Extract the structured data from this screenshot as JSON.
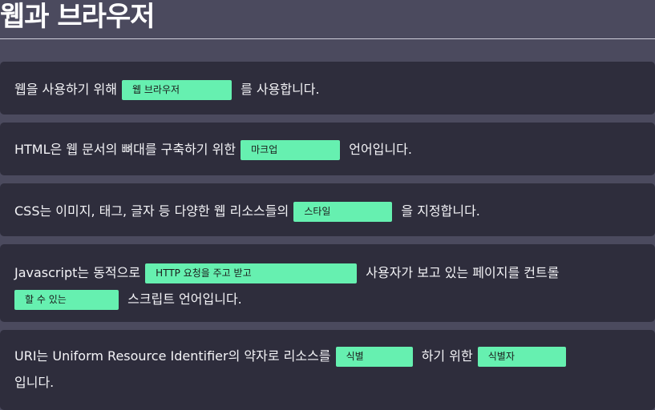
{
  "page": {
    "title": "웹과 브라우저"
  },
  "colors": {
    "page_background": "#4b4a5e",
    "card_background": "#2e2d3c",
    "blank_fill": "#66f0b0",
    "text": "#f4f4f7"
  },
  "cards": [
    {
      "text_1": "웹을 사용하기 위해",
      "blank_1": "웹 브라우저",
      "text_2": "를 사용합니다."
    },
    {
      "text_1": "HTML은 웹 문서의 뼈대를 구축하기 위한",
      "blank_1": "마크업",
      "text_2": "언어입니다."
    },
    {
      "text_1": "CSS는 이미지, 태그, 글자 등 다양한 웹 리소스들의",
      "blank_1": "스타일",
      "text_2": "을 지정합니다."
    },
    {
      "text_1": "Javascript는 동적으로",
      "blank_1": "HTTP 요청을 주고 받고",
      "text_2": "사용자가 보고 있는 페이지를 컨트롤",
      "blank_2": "할 수 있는",
      "text_3": "스크립트 언어입니다."
    },
    {
      "text_1": "URI는 Uniform Resource Identifier의 약자로 리소스를",
      "blank_1": "식별",
      "text_2": "하기 위한",
      "blank_2": "식별자",
      "text_3": "입니다."
    }
  ]
}
